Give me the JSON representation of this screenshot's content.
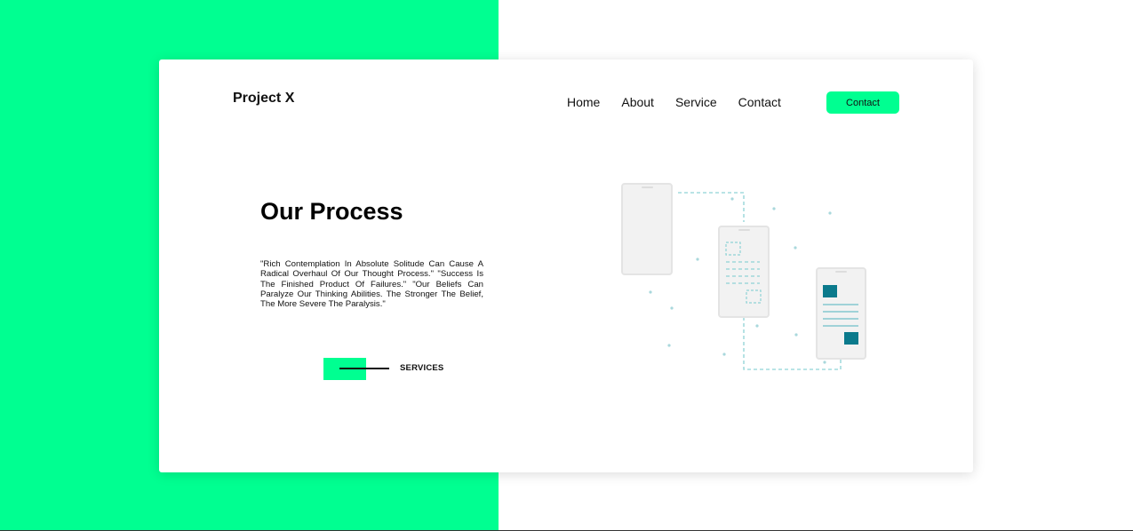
{
  "colors": {
    "accent": "#00ff91",
    "background": "#ffffff",
    "illustration_accent": "#0b7a8c",
    "illustration_line": "#8fd3d6",
    "phone_body": "#f2f2f2"
  },
  "header": {
    "brand": "Project X",
    "nav": [
      "Home",
      "About",
      "Service",
      "Contact"
    ],
    "contact_button": "Contact"
  },
  "hero": {
    "title": "Our Process",
    "quote": "\"Rich Contemplation In Absolute Solitude Can Cause A Radical Overhaul Of Our Thought Process.\" \"Success Is The Finished Product Of Failures.\" \"Our Beliefs Can Paralyze Our Thinking Abilities. The Stronger The Belief, The More Severe The Paralysis.\"",
    "services_label": "SERVICES"
  },
  "illustration": {
    "icon": "phones-process-illustration"
  }
}
